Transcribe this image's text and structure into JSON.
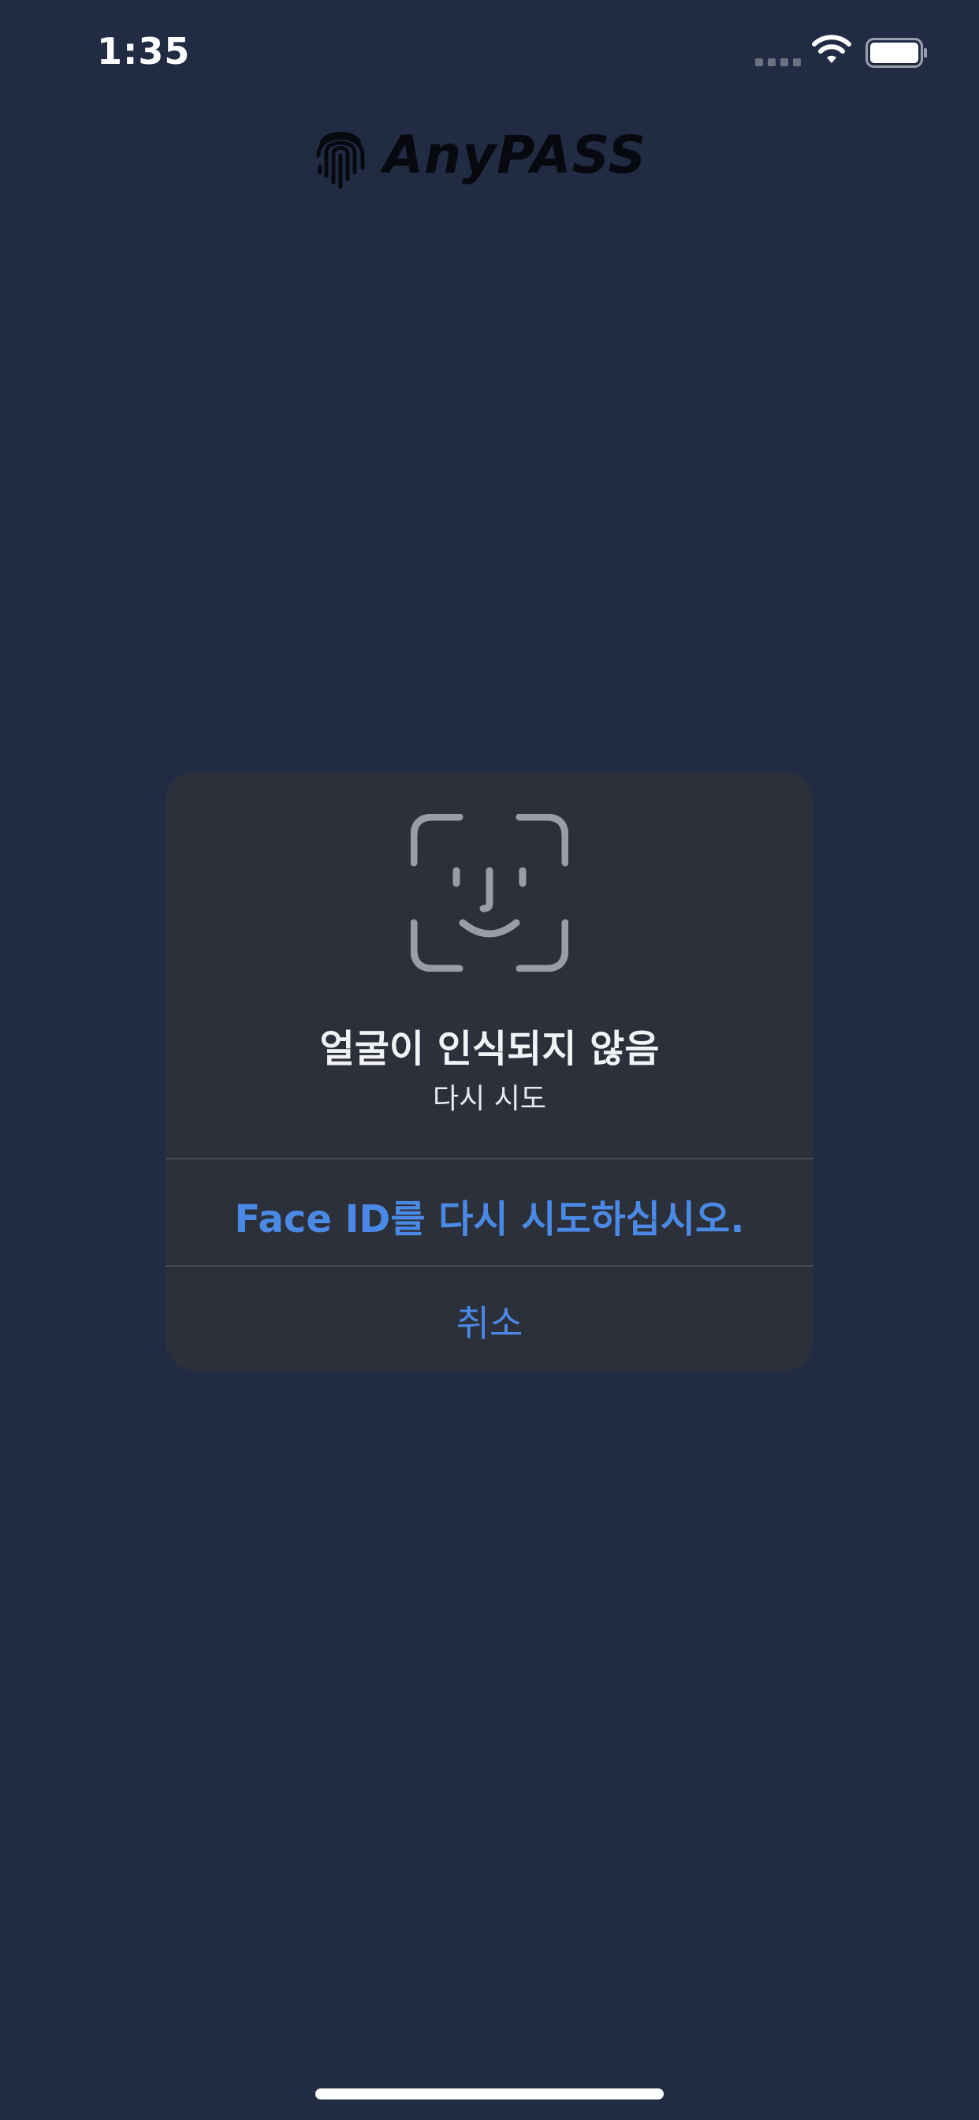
{
  "status_bar": {
    "time": "1:35",
    "icons": [
      "cellular-signal-icon",
      "wifi-icon",
      "battery-icon"
    ]
  },
  "app": {
    "logo_text": "AnyPASS",
    "logo_icon": "fingerprint-icon"
  },
  "dialog": {
    "icon": "face-id-icon",
    "title": "얼굴이 인식되지 않음",
    "subtitle": "다시 시도",
    "retry_label": "Face ID를 다시 시도하십시오.",
    "cancel_label": "취소"
  },
  "colors": {
    "background": "#212b43",
    "dialog_background": "#2c303a",
    "accent": "#4a8ae6"
  }
}
